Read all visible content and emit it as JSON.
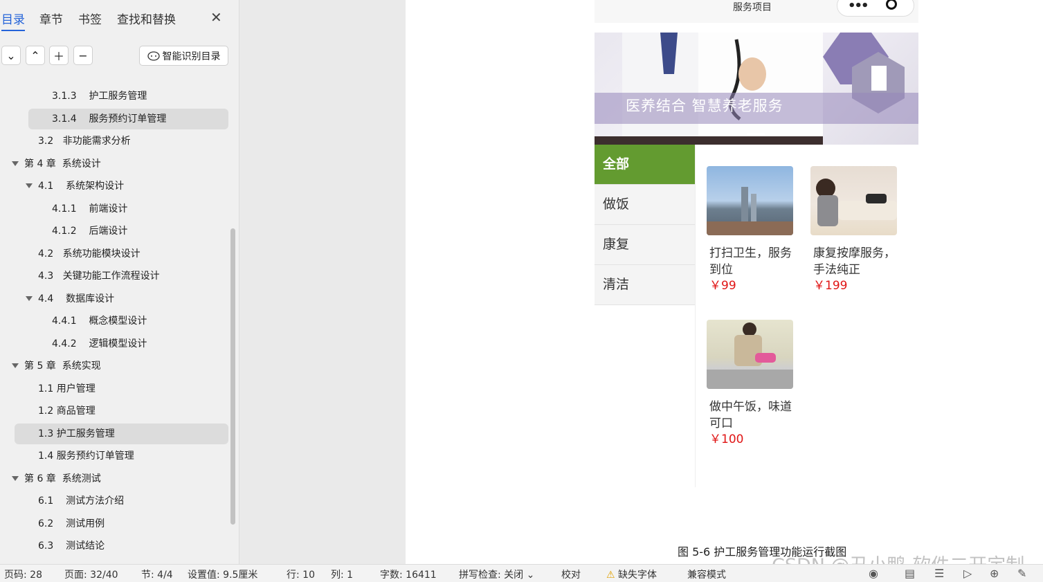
{
  "nav": {
    "tabs": [
      "目录",
      "章节",
      "书签",
      "查找和替换"
    ],
    "close_icon": "close-icon",
    "toolbar_icons": [
      "chevron-down-icon",
      "chevron-up-icon",
      "plus-icon",
      "minus-icon"
    ],
    "smart_button": "智能识别目录",
    "toc": [
      {
        "num": "3.1.3",
        "title": "护工服务管理"
      },
      {
        "num": "3.1.4",
        "title": "服务预约订单管理"
      },
      {
        "num": "3.2",
        "title": "非功能需求分析"
      },
      {
        "num": "第 4 章",
        "title": "系统设计"
      },
      {
        "num": "4.1",
        "title": "系统架构设计"
      },
      {
        "num": "4.1.1",
        "title": "前端设计"
      },
      {
        "num": "4.1.2",
        "title": "后端设计"
      },
      {
        "num": "4.2",
        "title": "系统功能模块设计"
      },
      {
        "num": "4.3",
        "title": "关键功能工作流程设计"
      },
      {
        "num": "4.4",
        "title": "数据库设计"
      },
      {
        "num": "4.4.1",
        "title": "概念模型设计"
      },
      {
        "num": "4.4.2",
        "title": "逻辑模型设计"
      },
      {
        "num": "第 5 章",
        "title": "系统实现"
      },
      {
        "num": "1.1",
        "title": "用户管理"
      },
      {
        "num": "1.2",
        "title": "商品管理"
      },
      {
        "num": "1.3",
        "title": "护工服务管理"
      },
      {
        "num": "1.4",
        "title": "服务预约订单管理"
      },
      {
        "num": "第 6 章",
        "title": "系统测试"
      },
      {
        "num": "6.1",
        "title": "测试方法介绍"
      },
      {
        "num": "6.2",
        "title": "测试用例"
      },
      {
        "num": "6.3",
        "title": "测试结论"
      }
    ]
  },
  "doc": {
    "mini_title": "服务项目",
    "banner_text": "医养结合  智慧养老服务",
    "categories": [
      "全部",
      "做饭",
      "康复",
      "清洁"
    ],
    "products": [
      {
        "name": "打扫卫生，服务到位",
        "price": "￥99"
      },
      {
        "name": "康复按摩服务，手法纯正",
        "price": "￥199"
      },
      {
        "name": "做中午饭，味道可口",
        "price": "￥100"
      }
    ],
    "caption": "图 5-6  护工服务管理功能运行截图"
  },
  "status": {
    "page": "页码: 28",
    "pages": "页面: 32/40",
    "section": "节: 4/4",
    "setting": "设置值: 9.5厘米",
    "row": "行: 10",
    "col": "列: 1",
    "words": "字数: 16411",
    "spell": "拼写检查: 关闭",
    "proof": "校对",
    "missing_font": "缺失字体",
    "compat": "兼容模式",
    "watermark": "CSDN @丑小鸭-软件二开定制"
  },
  "colors": {
    "accent": "#2463d9",
    "category_active": "#639b30",
    "price": "#e01515"
  }
}
